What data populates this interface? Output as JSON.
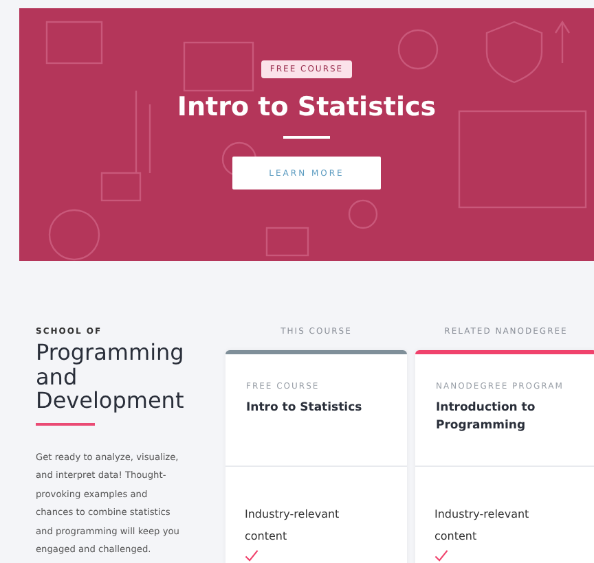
{
  "hero": {
    "badge": "FREE COURSE",
    "title": "Intro to Statistics",
    "button": "LEARN MORE"
  },
  "school": {
    "eyebrow": "SCHOOL OF",
    "title": "Programming and Development",
    "description": "Get ready to analyze, visualize, and interpret data! Thought-provoking examples and chances to combine statistics and programming will keep you engaged and challenged."
  },
  "columns": [
    {
      "heading": "THIS COURSE",
      "color": "#7f8f99",
      "type": "FREE COURSE",
      "title": "Intro to Statistics",
      "features": [
        "Industry-relevant content"
      ]
    },
    {
      "heading": "RELATED NANODEGREE",
      "color": "#f0426c",
      "type": "NANODEGREE PROGRAM",
      "title": "Introduction to Programming",
      "features": [
        "Industry-relevant content"
      ]
    }
  ]
}
